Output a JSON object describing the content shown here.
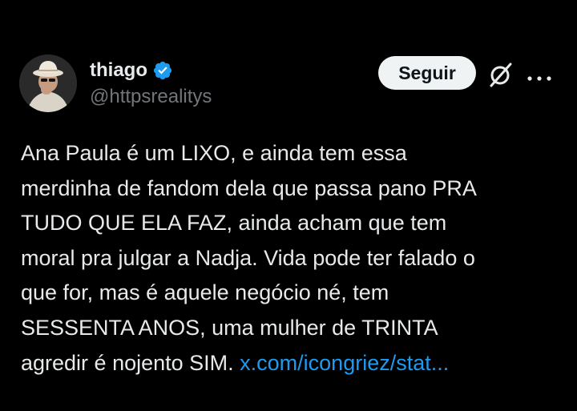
{
  "user": {
    "display_name": "thiago",
    "handle": "@httpsrealitys",
    "verified": true
  },
  "actions": {
    "follow_label": "Seguir",
    "grok_icon": "grok-slash-icon",
    "more_icon": "more-horizontal-icon"
  },
  "tweet": {
    "lines": [
      "Ana Paula é um LIXO, e ainda tem essa",
      "merdinha de fandom dela que passa pano PRA",
      "TUDO QUE ELA FAZ, ainda acham que tem",
      "moral pra julgar a Nadja. Vida pode ter falado o",
      "que for, mas é aquele negócio né, tem",
      "SESSENTA ANOS, uma mulher de TRINTA"
    ],
    "last_line_text": "agredir é nojento SIM. ",
    "link_text": "x.com/icongriez/stat..."
  },
  "colors": {
    "background": "#000000",
    "text": "#e7e9ea",
    "secondary": "#71767b",
    "link": "#1d9bf0",
    "verified_badge": "#1d9bf0",
    "button_bg": "#eff3f4",
    "button_text": "#0f1419"
  }
}
